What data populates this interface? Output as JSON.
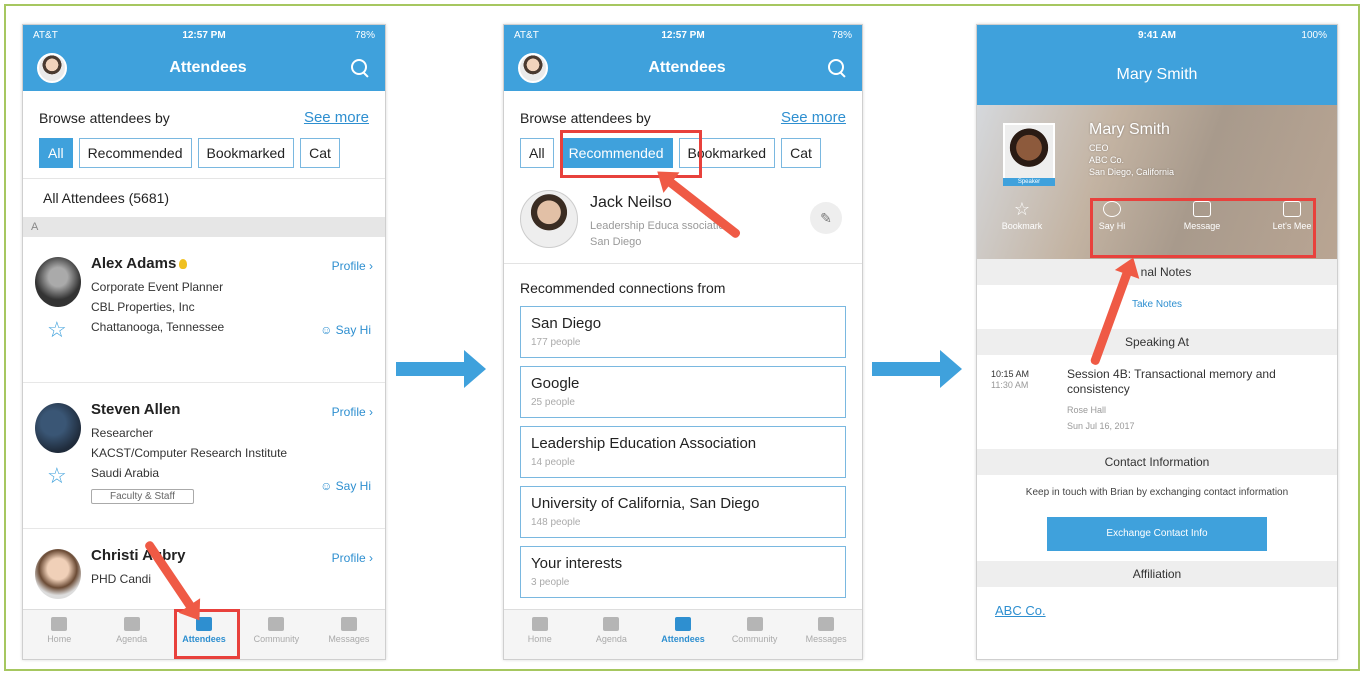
{
  "screen1": {
    "status": {
      "carrier": "AT&T",
      "time": "12:57 PM",
      "battery": "78%"
    },
    "title": "Attendees",
    "browse_label": "Browse attendees by",
    "see_more": "See more",
    "chips": [
      {
        "label": "All",
        "active": true
      },
      {
        "label": "Recommended",
        "active": false
      },
      {
        "label": "Bookmarked",
        "active": false
      },
      {
        "label": "Cat",
        "active": false
      }
    ],
    "all_count": "All Attendees (5681)",
    "section": "A",
    "people": [
      {
        "name": "Alex Adams",
        "lines": [
          "Corporate Event Planner",
          "CBL Properties, Inc",
          "Chattanooga, Tennessee"
        ],
        "tag": "",
        "profile": "Profile",
        "say_hi": "Say Hi"
      },
      {
        "name": "Steven Allen",
        "lines": [
          "Researcher",
          "KACST/Computer Research Institute",
          "Saudi Arabia"
        ],
        "tag": "Faculty & Staff",
        "profile": "Profile",
        "say_hi": "Say Hi"
      },
      {
        "name": "Christi Aubry",
        "lines": [
          "PHD Candi"
        ],
        "tag": "",
        "profile": "Profile",
        "say_hi": ""
      }
    ],
    "tabs": [
      {
        "label": "Home"
      },
      {
        "label": "Agenda"
      },
      {
        "label": "Attendees",
        "active": true
      },
      {
        "label": "Community"
      },
      {
        "label": "Messages"
      }
    ]
  },
  "screen2": {
    "status": {
      "carrier": "AT&T",
      "time": "12:57 PM",
      "battery": "78%"
    },
    "title": "Attendees",
    "browse_label": "Browse attendees by",
    "see_more": "See more",
    "chips": [
      {
        "label": "All"
      },
      {
        "label": "Recommended",
        "active": true
      },
      {
        "label": "Bookmarked"
      },
      {
        "label": "Cat"
      }
    ],
    "user": {
      "name": "Jack Neilso",
      "org": "Leadership Educa      ssociation",
      "city": "San Diego"
    },
    "rec_title": "Recommended connections from",
    "recs": [
      {
        "name": "San Diego",
        "count": "177 people"
      },
      {
        "name": "Google",
        "count": "25 people"
      },
      {
        "name": "Leadership Education Association",
        "count": "14 people"
      },
      {
        "name": "University of California, San Diego",
        "count": "148 people"
      },
      {
        "name": "Your interests",
        "count": "3 people"
      }
    ],
    "tabs": [
      {
        "label": "Home"
      },
      {
        "label": "Agenda"
      },
      {
        "label": "Attendees",
        "active": true
      },
      {
        "label": "Community"
      },
      {
        "label": "Messages"
      }
    ]
  },
  "screen3": {
    "status": {
      "carrier": "",
      "time": "9:41 AM",
      "battery": "100%"
    },
    "title": "Mary Smith",
    "profile": {
      "name": "Mary Smith",
      "role": "CEO",
      "company": "ABC Co.",
      "location": "San Diego, California",
      "badge": "Speaker"
    },
    "actions": [
      {
        "label": "Bookmark"
      },
      {
        "label": "Say Hi"
      },
      {
        "label": "Message"
      },
      {
        "label": "Let's Mee"
      }
    ],
    "personal_notes": "Pe     nal Notes",
    "take_notes": "Take Notes",
    "speaking_at": "Speaking At",
    "session": {
      "start": "10:15 AM",
      "end": "11:30 AM",
      "title": "Session 4B: Transactional memory and consistency",
      "room": "Rose Hall",
      "date": "Sun Jul 16, 2017"
    },
    "contact_header": "Contact Information",
    "contact_text": "Keep in touch with Brian by exchanging contact information",
    "exchange_button": "Exchange Contact Info",
    "affiliation_header": "Affiliation",
    "affiliation": "ABC Co."
  },
  "colors": {
    "brand": "#3fa1dc",
    "highlight": "#e8413c",
    "frame": "#a6c760"
  }
}
